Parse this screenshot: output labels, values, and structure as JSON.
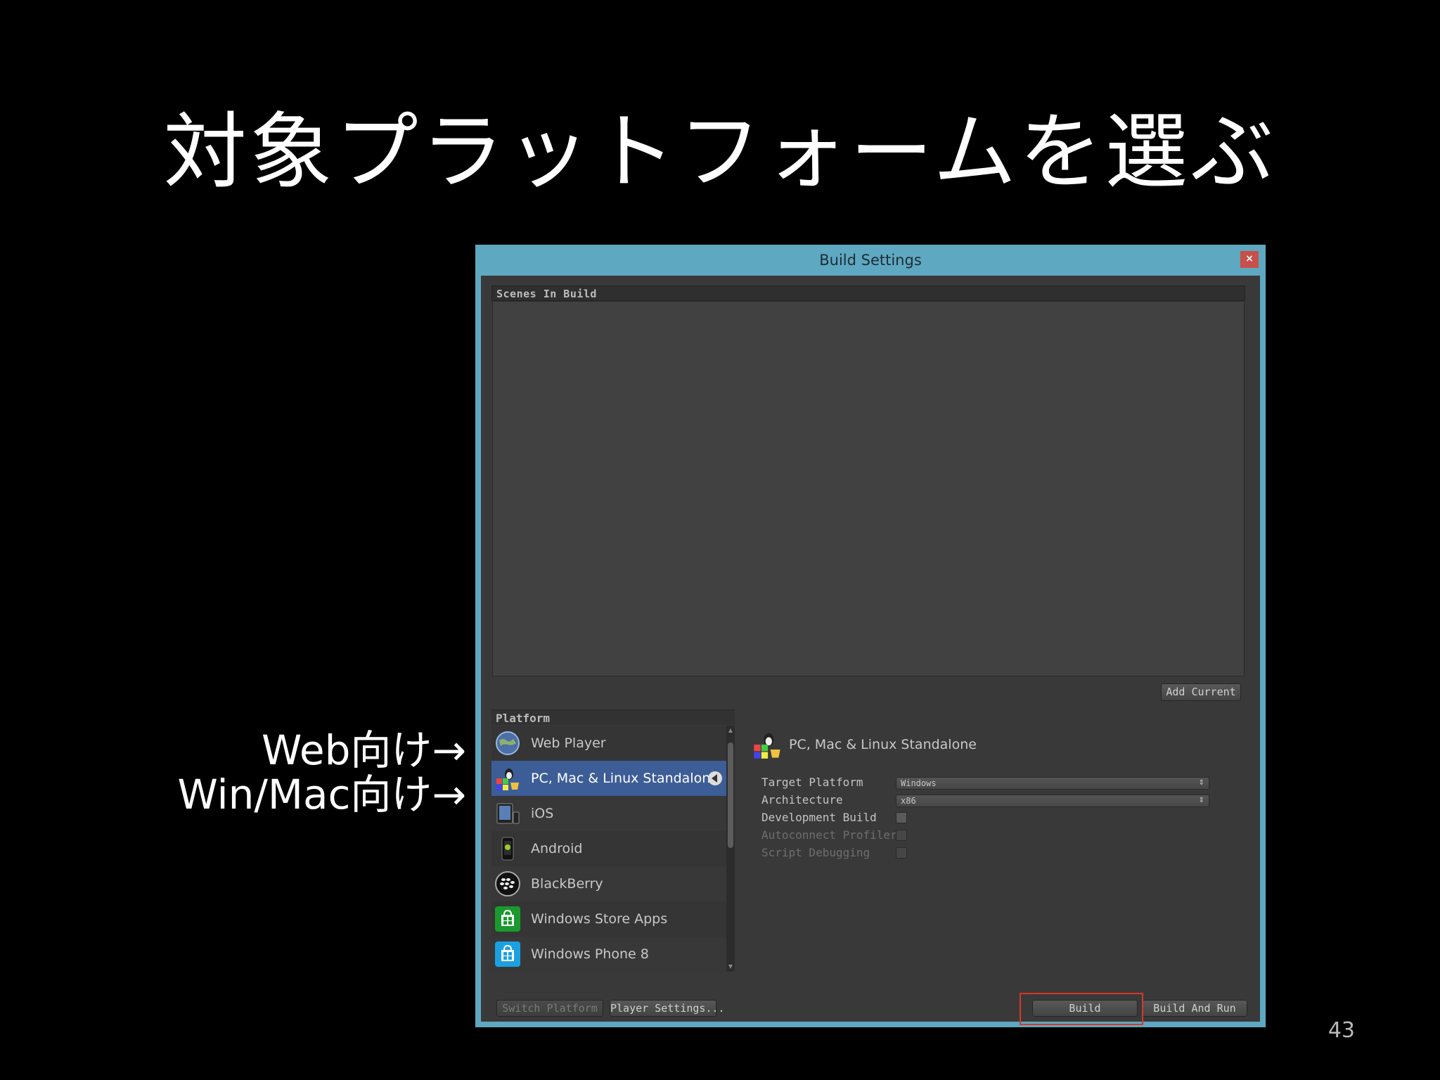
{
  "slide": {
    "title": "対象プラットフォームを選ぶ",
    "annotations": [
      "Web向け→",
      "Win/Mac向け→"
    ],
    "page_number": "43"
  },
  "window": {
    "title": "Build Settings",
    "close_label": "×"
  },
  "scenes": {
    "header": "Scenes In Build",
    "add_current_label": "Add Current"
  },
  "platform": {
    "header": "Platform",
    "items": [
      {
        "label": "Web Player",
        "icon": "web-player-icon",
        "selected": false
      },
      {
        "label": "PC, Mac & Linux Standalone",
        "icon": "standalone-icon",
        "selected": true
      },
      {
        "label": "iOS",
        "icon": "ios-icon",
        "selected": false
      },
      {
        "label": "Android",
        "icon": "android-icon",
        "selected": false
      },
      {
        "label": "BlackBerry",
        "icon": "blackberry-icon",
        "selected": false
      },
      {
        "label": "Windows Store Apps",
        "icon": "windows-store-icon",
        "selected": false
      },
      {
        "label": "Windows Phone 8",
        "icon": "windows-phone-icon",
        "selected": false
      }
    ]
  },
  "settings": {
    "selected_platform": "PC, Mac & Linux Standalone",
    "target_platform_label": "Target Platform",
    "target_platform_value": "Windows",
    "architecture_label": "Architecture",
    "architecture_value": "x86",
    "development_build_label": "Development Build",
    "autoconnect_profiler_label": "Autoconnect Profiler",
    "script_debugging_label": "Script Debugging"
  },
  "buttons": {
    "switch_platform": "Switch Platform",
    "player_settings": "Player Settings...",
    "build": "Build",
    "build_and_run": "Build And Run"
  },
  "colors": {
    "window_frame": "#5fa8c1",
    "selected_row": "#3d5d97",
    "highlight_box": "#d8362a"
  }
}
